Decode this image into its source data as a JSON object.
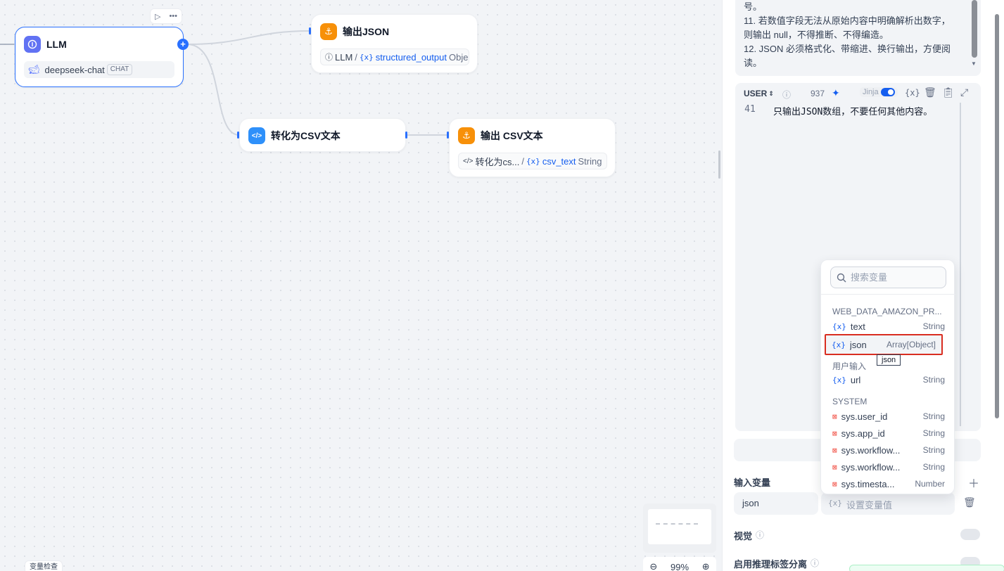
{
  "canvas": {
    "llm_node": {
      "title": "LLM",
      "model": "deepseek-chat",
      "model_tag": "CHAT"
    },
    "json_node": {
      "title": "输出JSON",
      "src": "LLM",
      "sep": "/",
      "var": "structured_output",
      "type": "Object"
    },
    "csv_node": {
      "title": "转化为CSV文本"
    },
    "csv_out_node": {
      "title": "输出 CSV文本",
      "src": "转化为cs...",
      "sep": "/",
      "var": "csv_text",
      "type": "String"
    },
    "zoom": "99%",
    "var_check": "变量检查"
  },
  "panel": {
    "system_text": "号。\n11. 若数值字段无法从原始内容中明确解析出数字，\n则输出 null，不得推断、不得编造。\n12. JSON 必须格式化、带缩进、换行输出，方便阅\n读。",
    "user_role": "USER",
    "char_count": "937",
    "jinja_label": "Jinja",
    "code_line_no": "41",
    "code_line": "只输出JSON数组，不要任何其他内容。",
    "input_vars_label": "输入变量",
    "input_var_name": "json",
    "input_var_placeholder": "设置变量值",
    "vision_label": "视觉",
    "reasoning_label": "启用推理标签分离"
  },
  "dropdown": {
    "search_placeholder": "搜索变量",
    "groups": [
      {
        "name": "WEB_DATA_AMAZON_PR...",
        "items": [
          {
            "name": "text",
            "type": "String"
          },
          {
            "name": "json",
            "type": "Array[Object]"
          }
        ]
      },
      {
        "name": "用户输入",
        "items": [
          {
            "name": "url",
            "type": "String"
          }
        ]
      },
      {
        "name": "SYSTEM",
        "items": [
          {
            "name": "sys.user_id",
            "type": "String"
          },
          {
            "name": "sys.app_id",
            "type": "String"
          },
          {
            "name": "sys.workflow...",
            "type": "String"
          },
          {
            "name": "sys.workflow...",
            "type": "String"
          },
          {
            "name": "sys.timesta...",
            "type": "Number"
          }
        ]
      }
    ],
    "tooltip": "json"
  },
  "colors": {
    "accent": "#2970ff",
    "llm_icon": "#6172f3",
    "output_icon": "#f79009",
    "code_icon": "#2e90fa",
    "highlight": "#d92d20"
  }
}
